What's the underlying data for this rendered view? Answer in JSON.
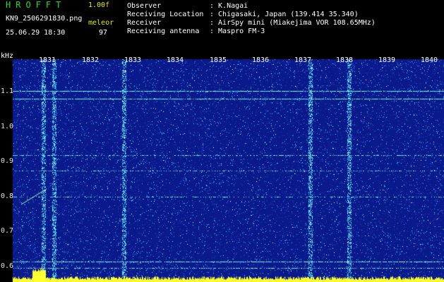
{
  "header": {
    "app_name": "HROFFT",
    "version": "1.00f",
    "file_name": "KN9_2506291830.png",
    "detection": "meleor",
    "datetime": "25.06.29 18:30",
    "count": "97",
    "info": [
      {
        "label": "Observer",
        "value": ": K.Nagai"
      },
      {
        "label": "Receiving Location",
        "value": ": Chigasaki, Japan (139.414 35.340)"
      },
      {
        "label": "Receiver",
        "value": ": AirSpy mini (Miakejima VOR 108.65MHz)"
      },
      {
        "label": "Receiving antenna",
        "value": ": Maspro FM-3"
      }
    ]
  },
  "plot": {
    "y_unit": "kHz",
    "y_ticks": [
      "1.1",
      "1.0",
      "0.9",
      "0.8",
      "0.7",
      "0.6"
    ],
    "x_ticks": [
      "1831",
      "1832",
      "1833",
      "1834",
      "1835",
      "1836",
      "1837",
      "1838",
      "1839",
      "1840"
    ],
    "colors": {
      "background": "#0a1a8a",
      "noise_light": "#3c8cff",
      "noise_cyan": "#40e8ff",
      "signal": "#a8ffb0",
      "bottom": "#ffff30"
    }
  }
}
